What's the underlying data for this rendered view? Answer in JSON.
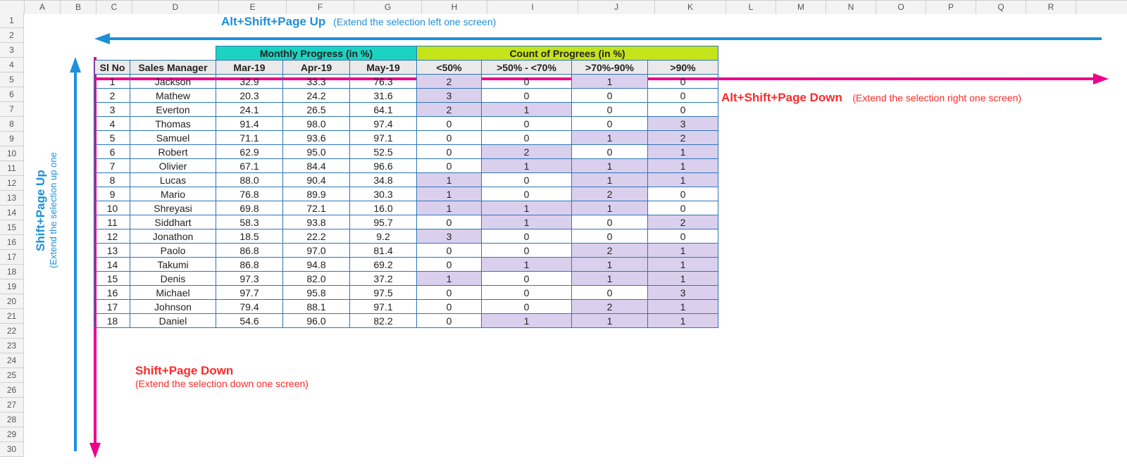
{
  "columns": {
    "letters": [
      "A",
      "B",
      "C",
      "D",
      "E",
      "F",
      "G",
      "H",
      "I",
      "J",
      "K",
      "L",
      "M",
      "N",
      "O",
      "P",
      "Q",
      "R"
    ],
    "widths": [
      50,
      50,
      50,
      122,
      95,
      95,
      95,
      92,
      128,
      108,
      100,
      70,
      70,
      70,
      70,
      70,
      70,
      70
    ]
  },
  "row_count": 30,
  "table": {
    "position": {
      "col": "C",
      "row": 4
    },
    "monthly_progress_header": "Monthly Progress (in %)",
    "count_progress_header": "Count of Progrees (in %)",
    "sub_headers": [
      "Sl No",
      "Sales Manager",
      "Mar-19",
      "Apr-19",
      "May-19",
      "<50%",
      ">50% - <70%",
      ">70%-90%",
      ">90%"
    ],
    "rows": [
      {
        "sl": 1,
        "mgr": "Jackson",
        "mar": "32.9",
        "apr": "33.3",
        "may": "76.3",
        "c1": "2",
        "c2": "0",
        "c3": "1",
        "c4": "0",
        "hi": [
          "c1",
          "c3"
        ]
      },
      {
        "sl": 2,
        "mgr": "Mathew",
        "mar": "20.3",
        "apr": "24.2",
        "may": "31.6",
        "c1": "3",
        "c2": "0",
        "c3": "0",
        "c4": "0",
        "hi": [
          "c1"
        ]
      },
      {
        "sl": 3,
        "mgr": "Everton",
        "mar": "24.1",
        "apr": "26.5",
        "may": "64.1",
        "c1": "2",
        "c2": "1",
        "c3": "0",
        "c4": "0",
        "hi": [
          "c1",
          "c2"
        ]
      },
      {
        "sl": 4,
        "mgr": "Thomas",
        "mar": "91.4",
        "apr": "98.0",
        "may": "97.4",
        "c1": "0",
        "c2": "0",
        "c3": "0",
        "c4": "3",
        "hi": [
          "c4"
        ]
      },
      {
        "sl": 5,
        "mgr": "Samuel",
        "mar": "71.1",
        "apr": "93.6",
        "may": "97.1",
        "c1": "0",
        "c2": "0",
        "c3": "1",
        "c4": "2",
        "hi": [
          "c3",
          "c4"
        ]
      },
      {
        "sl": 6,
        "mgr": "Robert",
        "mar": "62.9",
        "apr": "95.0",
        "may": "52.5",
        "c1": "0",
        "c2": "2",
        "c3": "0",
        "c4": "1",
        "hi": [
          "c2",
          "c4"
        ]
      },
      {
        "sl": 7,
        "mgr": "Olivier",
        "mar": "67.1",
        "apr": "84.4",
        "may": "96.6",
        "c1": "0",
        "c2": "1",
        "c3": "1",
        "c4": "1",
        "hi": [
          "c2",
          "c3",
          "c4"
        ]
      },
      {
        "sl": 8,
        "mgr": "Lucas",
        "mar": "88.0",
        "apr": "90.4",
        "may": "34.8",
        "c1": "1",
        "c2": "0",
        "c3": "1",
        "c4": "1",
        "hi": [
          "c1",
          "c3",
          "c4"
        ]
      },
      {
        "sl": 9,
        "mgr": "Mario",
        "mar": "76.8",
        "apr": "89.9",
        "may": "30.3",
        "c1": "1",
        "c2": "0",
        "c3": "2",
        "c4": "0",
        "hi": [
          "c1",
          "c3"
        ]
      },
      {
        "sl": 10,
        "mgr": "Shreyasi",
        "mar": "69.8",
        "apr": "72.1",
        "may": "16.0",
        "c1": "1",
        "c2": "1",
        "c3": "1",
        "c4": "0",
        "hi": [
          "c1",
          "c2",
          "c3"
        ]
      },
      {
        "sl": 11,
        "mgr": "Siddhart",
        "mar": "58.3",
        "apr": "93.8",
        "may": "95.7",
        "c1": "0",
        "c2": "1",
        "c3": "0",
        "c4": "2",
        "hi": [
          "c2",
          "c4"
        ]
      },
      {
        "sl": 12,
        "mgr": "Jonathon",
        "mar": "18.5",
        "apr": "22.2",
        "may": "9.2",
        "c1": "3",
        "c2": "0",
        "c3": "0",
        "c4": "0",
        "hi": [
          "c1"
        ]
      },
      {
        "sl": 13,
        "mgr": "Paolo",
        "mar": "86.8",
        "apr": "97.0",
        "may": "81.4",
        "c1": "0",
        "c2": "0",
        "c3": "2",
        "c4": "1",
        "hi": [
          "c3",
          "c4"
        ]
      },
      {
        "sl": 14,
        "mgr": "Takumi",
        "mar": "86.8",
        "apr": "94.8",
        "may": "69.2",
        "c1": "0",
        "c2": "1",
        "c3": "1",
        "c4": "1",
        "hi": [
          "c2",
          "c3",
          "c4"
        ]
      },
      {
        "sl": 15,
        "mgr": "Denis",
        "mar": "97.3",
        "apr": "82.0",
        "may": "37.2",
        "c1": "1",
        "c2": "0",
        "c3": "1",
        "c4": "1",
        "hi": [
          "c1",
          "c3",
          "c4"
        ]
      },
      {
        "sl": 16,
        "mgr": "Michael",
        "mar": "97.7",
        "apr": "95.8",
        "may": "97.5",
        "c1": "0",
        "c2": "0",
        "c3": "0",
        "c4": "3",
        "hi": [
          "c4"
        ]
      },
      {
        "sl": 17,
        "mgr": "Johnson",
        "mar": "79.4",
        "apr": "88.1",
        "may": "97.1",
        "c1": "0",
        "c2": "0",
        "c3": "2",
        "c4": "1",
        "hi": [
          "c3",
          "c4"
        ]
      },
      {
        "sl": 18,
        "mgr": "Daniel",
        "mar": "54.6",
        "apr": "96.0",
        "may": "82.2",
        "c1": "0",
        "c2": "1",
        "c3": "1",
        "c4": "1",
        "hi": [
          "c2",
          "c3",
          "c4"
        ]
      }
    ]
  },
  "annotations": {
    "alt_shift_pgup": {
      "title": "Alt+Shift+Page Up",
      "desc": "(Extend the selection left one screen)"
    },
    "alt_shift_pgdn": {
      "title": "Alt+Shift+Page Down",
      "desc": "(Extend the selection right one screen)"
    },
    "shift_pgup": {
      "title": "Shift+Page Up",
      "desc": "(Extend the selection up one"
    },
    "shift_pgdn": {
      "title": "Shift+Page Down",
      "desc": "(Extend the selection down one screen)"
    }
  },
  "colors": {
    "blue": "#1e90d8",
    "magenta": "#ec008c",
    "red": "#ff2a2a"
  }
}
